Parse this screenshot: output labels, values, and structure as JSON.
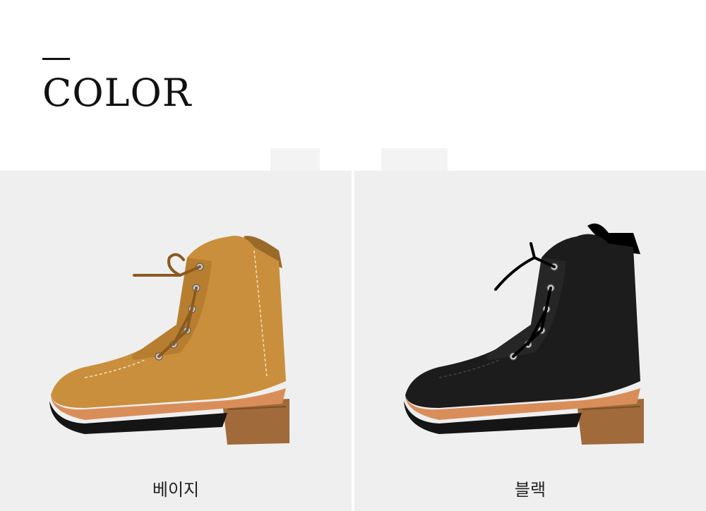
{
  "section": {
    "title": "COLOR"
  },
  "variants": [
    {
      "label": "베이지",
      "color": "#c98f3c",
      "shade": "#9a6a28"
    },
    {
      "label": "블랙",
      "color": "#1c1c1c",
      "shade": "#000000"
    }
  ],
  "colors": {
    "panel_bg": "#efefef",
    "sole": "#151515",
    "welt": "#d98e5a",
    "heel": "#a06a3a",
    "eyelet": "#c8c8c8"
  }
}
